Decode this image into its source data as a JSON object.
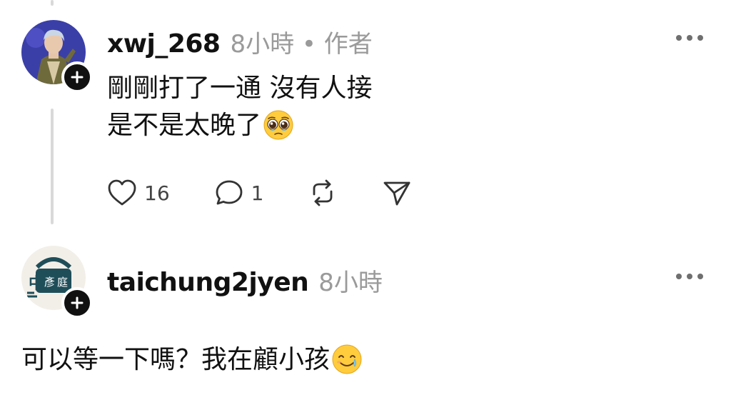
{
  "posts": [
    {
      "username": "xwj_268",
      "meta": "8小時 • 作者",
      "lines": [
        "剛剛打了一通 沒有人接",
        "是不是太晚了"
      ],
      "emoji": "pleading-face",
      "likes": "16",
      "replies": "1"
    },
    {
      "username": "taichung2jyen",
      "meta": "8小時",
      "lines": [
        "可以等一下嗎？我在顧小孩"
      ],
      "emoji": "smiling-face-with-tear"
    }
  ],
  "colors": {
    "line": "#d9d9d9",
    "meta": "#9a9a9a",
    "text": "#111111"
  }
}
